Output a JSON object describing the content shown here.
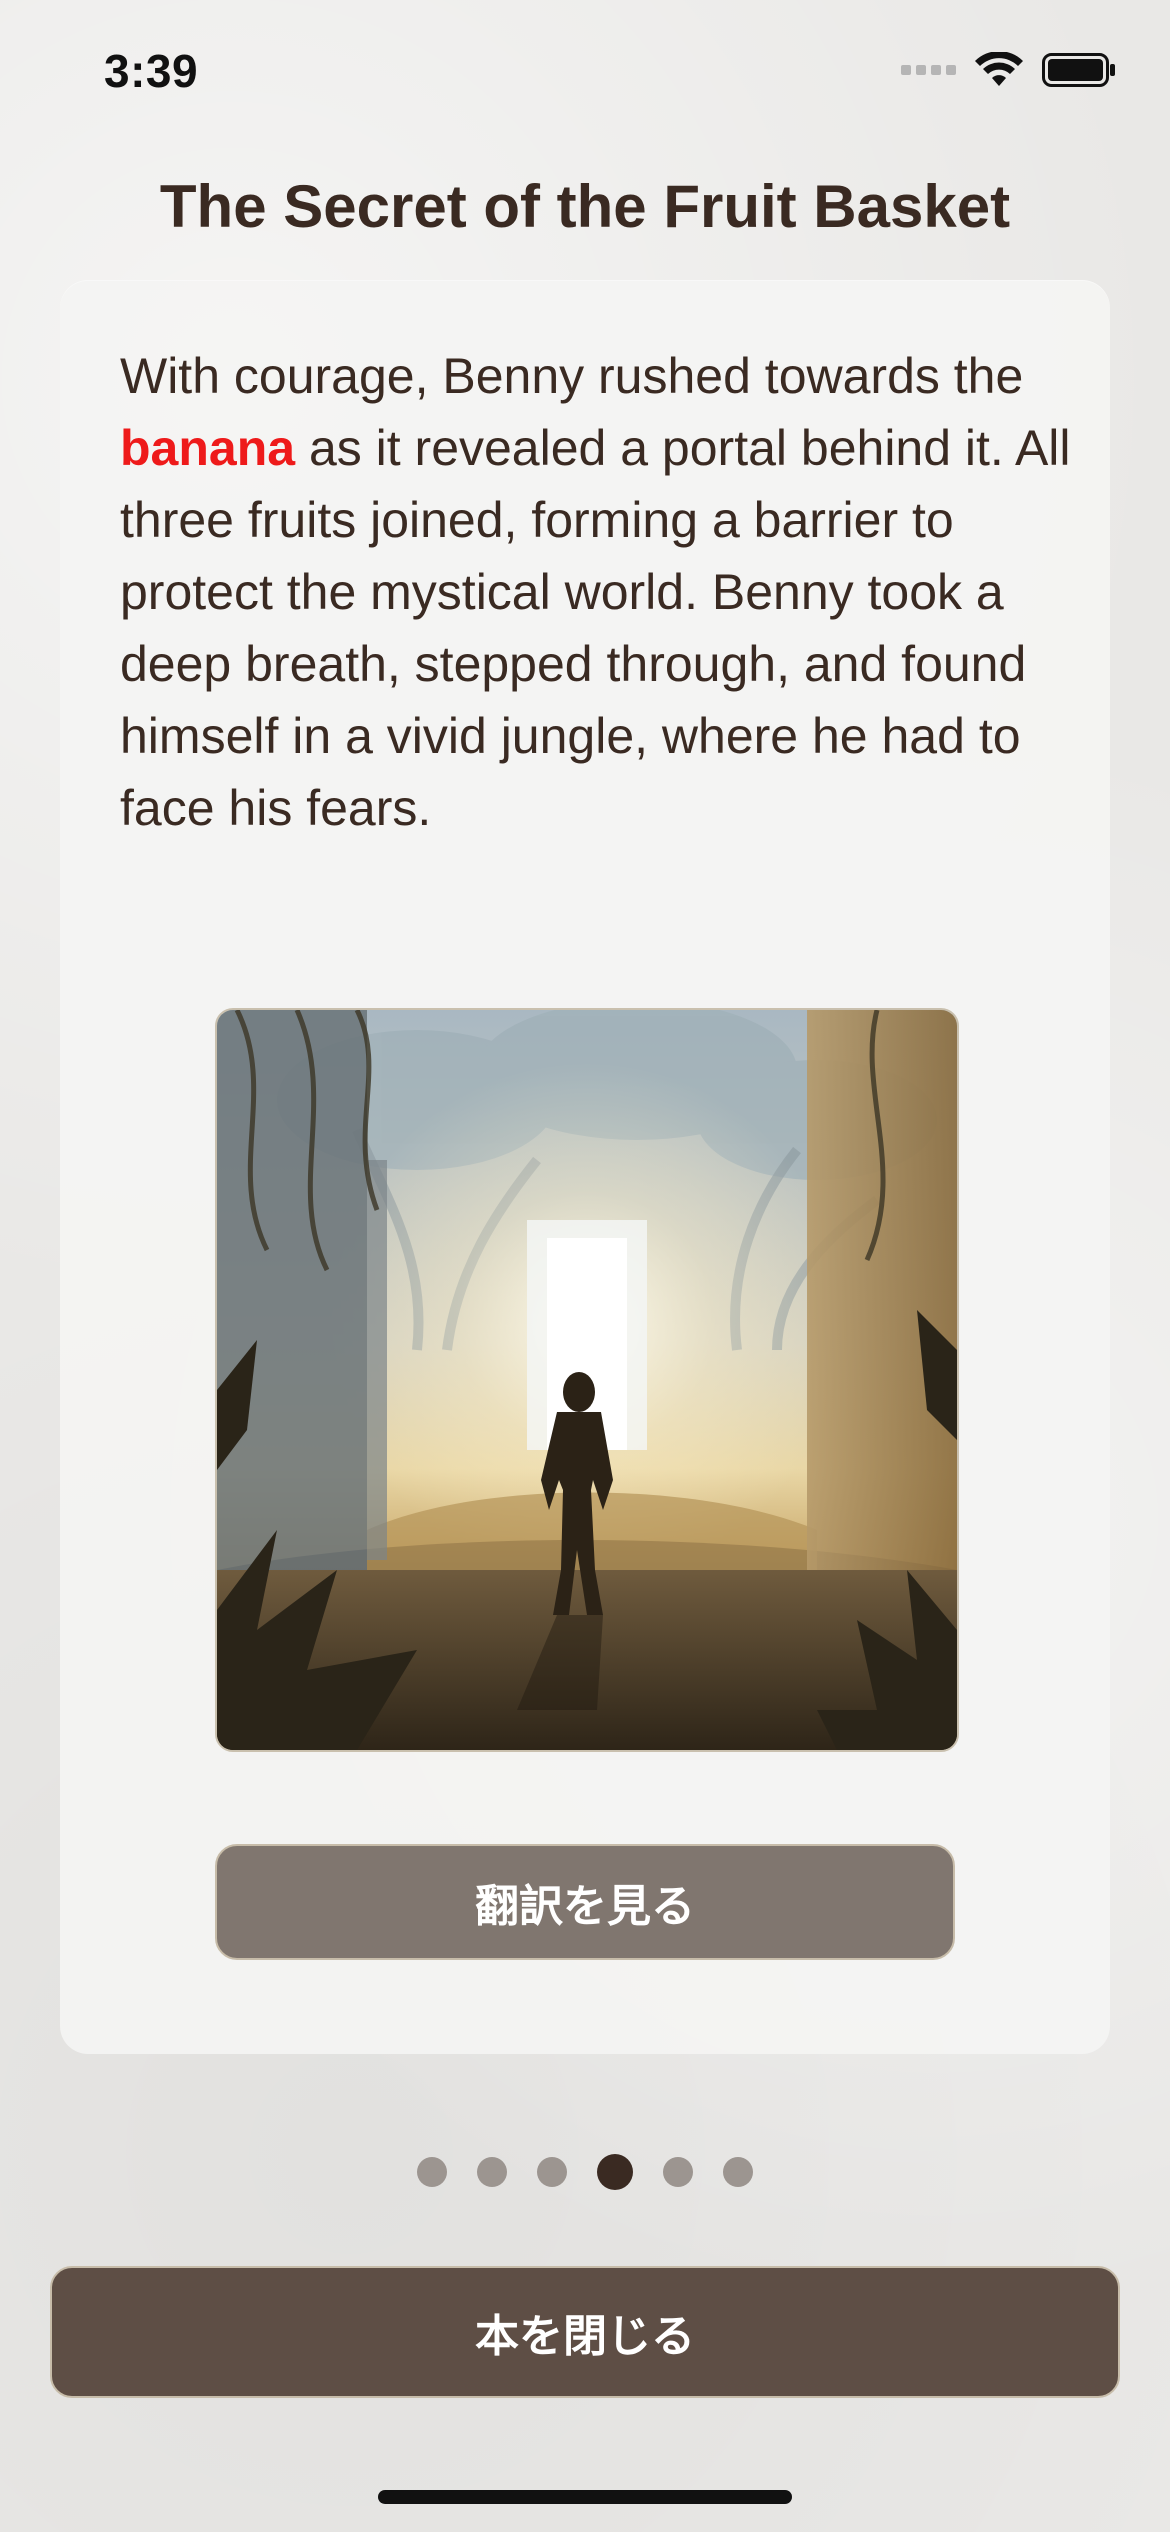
{
  "status_bar": {
    "time": "3:39",
    "icons": [
      "signal-icon",
      "wifi-icon",
      "battery-icon"
    ]
  },
  "title": "The Secret of the Fruit Basket",
  "story": {
    "text_before": "With courage, Benny rushed towards the ",
    "highlight_word": "banana",
    "text_after": " as it revealed a portal behind it. All three fruits joined, forming a barrier to protect the mystical world. Benny took a deep breath, stepped through, and found himself in a vivid jungle, where he had to face his fears."
  },
  "illustration": {
    "icon": "jungle-portal-illustration"
  },
  "buttons": {
    "translate_label": "翻訳を見る",
    "close_book_label": "本を閉じる"
  },
  "pagination": {
    "total_pages": 6,
    "current_page": 4
  },
  "colors": {
    "highlight": "#ee1a1a",
    "title": "#3a2a22",
    "translate_button": "#80766f",
    "close_button": "#5e4e45",
    "dot_inactive": "#9c9590",
    "dot_active": "#3a2a22"
  }
}
